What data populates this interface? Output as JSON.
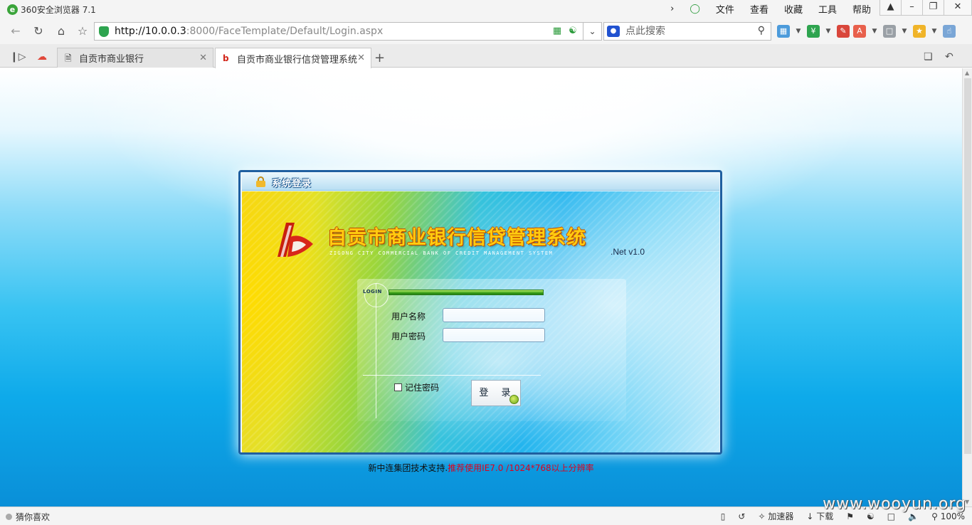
{
  "browser": {
    "app_title": "360安全浏览器 7.1",
    "menus": [
      "文件",
      "查看",
      "收藏",
      "工具",
      "帮助"
    ],
    "url_host": "http://10.0.0.3",
    "url_rest": ":8000/FaceTemplate/Default/Login.aspx",
    "search_placeholder": "点此搜索",
    "tabs": [
      {
        "label": "自贡市商业银行",
        "active": false
      },
      {
        "label": "自贡市商业银行信贷管理系统",
        "active": true
      }
    ]
  },
  "login": {
    "header_title": "系统登录",
    "system_title": "自贡市商业银行信贷管理系统",
    "system_title_en": "ZIGONG CITY COMMERCIAL BANK OF CREDIT MANAGEMENT SYSTEM",
    "version": ".Net v1.0",
    "login_tag": "LOGIN",
    "username_label": "用户名称",
    "password_label": "用户密码",
    "remember_label": "记住密码",
    "login_button": "登 录"
  },
  "footer": {
    "support": "新中连集团技术支持.",
    "recommend": "推荐使用IE7.0 /1024*768以上分辨率"
  },
  "statusbar": {
    "left_label": "猜你喜欢",
    "accelerator": "加速器",
    "download": "下载",
    "zoom": "100%"
  },
  "watermark": "www.wooyun.org",
  "colors": {
    "frame_border": "#1f5fa0",
    "title_gold": "#ffcc10",
    "warning_red": "#e1001a",
    "brand_green": "#3aa43a"
  }
}
